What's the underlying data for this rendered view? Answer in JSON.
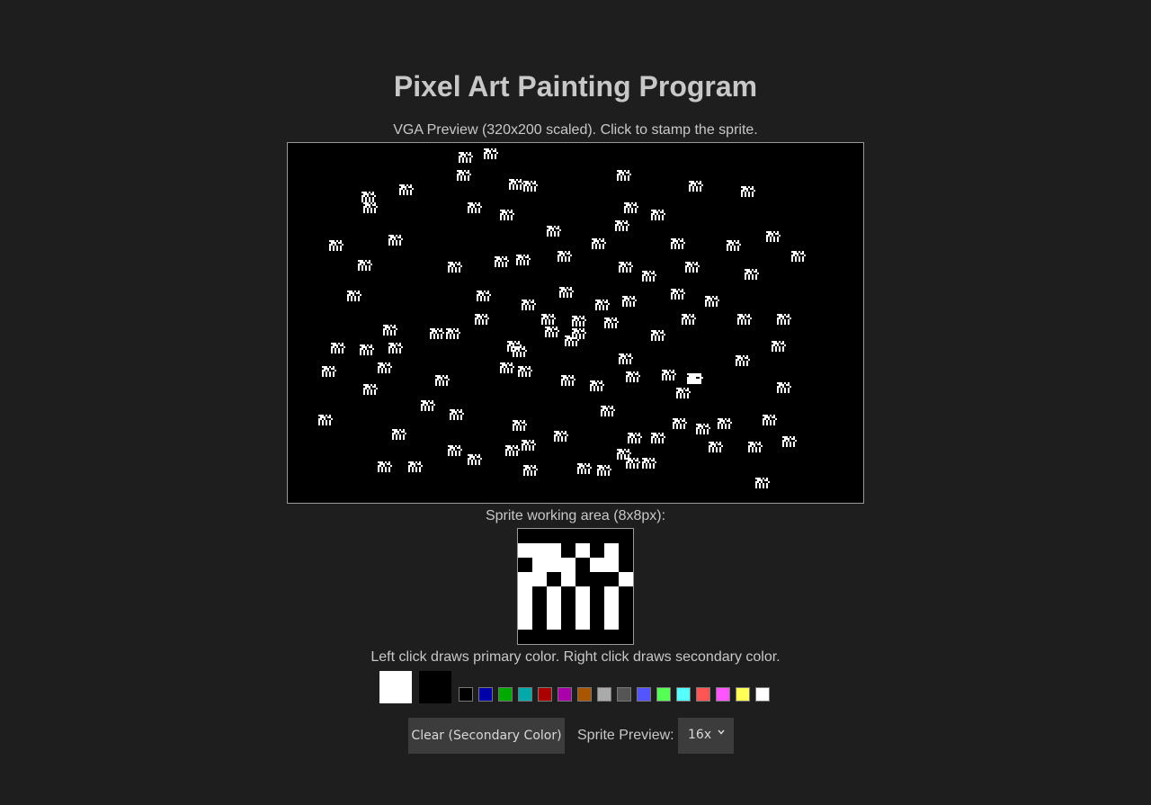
{
  "page": {
    "title": "Pixel Art Painting Program",
    "vga_caption": "VGA Preview (320x200 scaled). Click to stamp the sprite.",
    "sprite_caption": "Sprite working area (8x8px):",
    "click_hint": "Left click draws primary color. Right click draws secondary color."
  },
  "colors": {
    "primary": "#ffffff",
    "secondary": "#000000",
    "palette": [
      "#000000",
      "#0000aa",
      "#00aa00",
      "#00aaaa",
      "#aa0000",
      "#aa00aa",
      "#aa5500",
      "#aaaaaa",
      "#555555",
      "#5555ff",
      "#55ff55",
      "#55ffff",
      "#ff5555",
      "#ff55ff",
      "#ffff55",
      "#ffffff"
    ]
  },
  "sprite": {
    "pixels": [
      "00000000",
      "11101010",
      "01110110",
      "11010001",
      "10101010",
      "10101010",
      "10101010",
      "00000000"
    ]
  },
  "controls": {
    "clear_label": "Clear (Secondary Color)",
    "preview_label": "Sprite Preview:",
    "preview_value": "16x"
  }
}
